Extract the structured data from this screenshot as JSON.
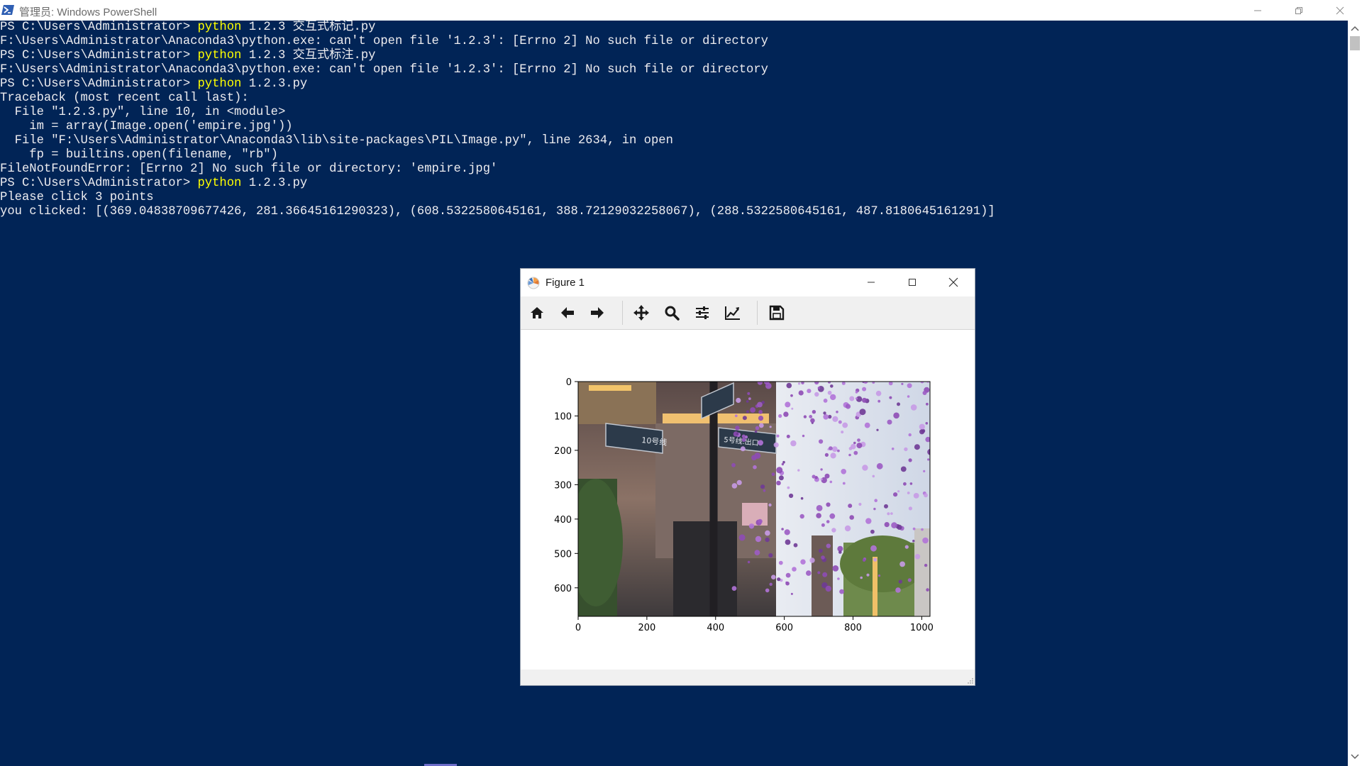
{
  "window": {
    "title": "管理员: Windows PowerShell"
  },
  "console": {
    "lines": [
      {
        "prompt": "PS C:\\Users\\Administrator> ",
        "cmd": "python",
        "rest": " 1.2.3 交互式标记.py"
      },
      {
        "prompt": "",
        "cmd": "",
        "rest": "F:\\Users\\Administrator\\Anaconda3\\python.exe: can't open file '1.2.3': [Errno 2] No such file or directory"
      },
      {
        "prompt": "PS C:\\Users\\Administrator> ",
        "cmd": "python",
        "rest": " 1.2.3 交互式标注.py"
      },
      {
        "prompt": "",
        "cmd": "",
        "rest": "F:\\Users\\Administrator\\Anaconda3\\python.exe: can't open file '1.2.3': [Errno 2] No such file or directory"
      },
      {
        "prompt": "PS C:\\Users\\Administrator> ",
        "cmd": "python",
        "rest": " 1.2.3.py"
      },
      {
        "prompt": "",
        "cmd": "",
        "rest": "Traceback (most recent call last):"
      },
      {
        "prompt": "",
        "cmd": "",
        "rest": "  File \"1.2.3.py\", line 10, in <module>"
      },
      {
        "prompt": "",
        "cmd": "",
        "rest": "    im = array(Image.open('empire.jpg'))"
      },
      {
        "prompt": "",
        "cmd": "",
        "rest": "  File \"F:\\Users\\Administrator\\Anaconda3\\lib\\site-packages\\PIL\\Image.py\", line 2634, in open"
      },
      {
        "prompt": "",
        "cmd": "",
        "rest": "    fp = builtins.open(filename, \"rb\")"
      },
      {
        "prompt": "",
        "cmd": "",
        "rest": "FileNotFoundError: [Errno 2] No such file or directory: 'empire.jpg'"
      },
      {
        "prompt": "PS C:\\Users\\Administrator> ",
        "cmd": "python",
        "rest": " 1.2.3.py"
      },
      {
        "prompt": "",
        "cmd": "",
        "rest": "Please click 3 points"
      },
      {
        "prompt": "",
        "cmd": "",
        "rest": "you clicked: [(369.04838709677426, 281.36645161290323), (608.5322580645161, 388.72129032258067), (288.5322580645161, 487.8180645161291)]"
      }
    ]
  },
  "figure": {
    "title": "Figure 1",
    "toolbar": [
      "home-icon",
      "back-icon",
      "forward-icon",
      "pan-icon",
      "zoom-icon",
      "configure-subplots-icon",
      "edit-axis-icon",
      "save-icon"
    ],
    "axes": {
      "xticks": [
        "0",
        "200",
        "400",
        "600",
        "800",
        "1000"
      ],
      "yticks": [
        "0",
        "100",
        "200",
        "300",
        "400",
        "500",
        "600"
      ],
      "xlim": [
        0,
        1024
      ],
      "ylim": [
        683,
        0
      ]
    },
    "image": {
      "street_sign_left": "10号线",
      "street_sign_right": "5号线.出口"
    }
  },
  "colors": {
    "console_bg": "#012456",
    "console_text": "#eeedf0",
    "command": "#ffff00"
  }
}
